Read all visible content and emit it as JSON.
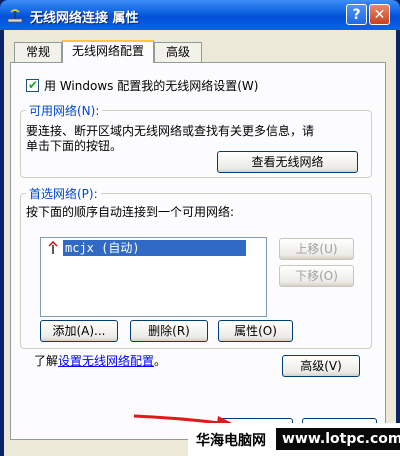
{
  "window": {
    "title": "无线网络连接 属性",
    "help_symbol": "?",
    "close_symbol": "✕"
  },
  "tabs": [
    {
      "label": "常规"
    },
    {
      "label": "无线网络配置"
    },
    {
      "label": "高级"
    }
  ],
  "use_windows_checkbox": {
    "checked": true,
    "label": "用 Windows 配置我的无线网络设置(W)"
  },
  "available": {
    "legend": "可用网络(N):",
    "text_line1": "要连接、断开区域内无线网络或查找有关更多信息，请",
    "text_line2": "单击下面的按钮。",
    "view_button": "查看无线网络"
  },
  "preferred": {
    "legend": "首选网络(P):",
    "text": "按下面的顺序自动连接到一个可用网络:",
    "networks": [
      {
        "name": "mcjx (自动)",
        "selected": true
      }
    ],
    "move_up": "上移(U)",
    "move_down": "下移(O)",
    "add": "添加(A)...",
    "remove": "删除(R)",
    "properties": "属性(O)"
  },
  "learn_prefix": "了解",
  "learn_link": "设置无线网络配置",
  "learn_suffix": "。",
  "advanced_button": "高级(V)",
  "watermark": {
    "text": "华海电脑网",
    "url": "www.lotpc.com"
  },
  "colors": {
    "titlebar": "#0350d6",
    "selection": "#316ac5",
    "dialog": "#ece9d8",
    "legend": "#0046d5",
    "arrow": "#e0191b"
  }
}
